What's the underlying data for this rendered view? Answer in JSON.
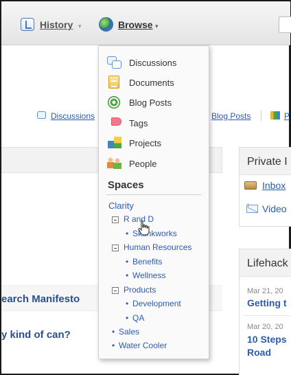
{
  "toolbar": {
    "history_label": "History",
    "history_caret": "▾",
    "browse_label": "Browse",
    "browse_caret": "▾"
  },
  "background": {
    "tab_discussions": "Discussions",
    "tab_blog_posts": "Blog Posts",
    "tab_p": "P",
    "left_text_1": "earch Manifesto",
    "left_text_2": "y kind of can?",
    "private_title": "Private I",
    "inbox_label": "Inbox",
    "video_label": "Video",
    "lifehacker_title": "Lifehack",
    "life_date_1": "Mar 21, 20",
    "life_link_1": "Getting t",
    "life_date_2": "Mar 20, 20",
    "life_link_2a": "10 Steps",
    "life_link_2b": "Road"
  },
  "browse_menu": {
    "items": [
      {
        "label": "Discussions",
        "icon": "discussions-icon"
      },
      {
        "label": "Documents",
        "icon": "documents-icon"
      },
      {
        "label": "Blog Posts",
        "icon": "blog-posts-icon"
      },
      {
        "label": "Tags",
        "icon": "tags-icon"
      },
      {
        "label": "Projects",
        "icon": "projects-icon"
      },
      {
        "label": "People",
        "icon": "people-icon"
      }
    ],
    "spaces_heading": "Spaces",
    "spaces": {
      "root": "Clarity",
      "r_and_d": "R and D",
      "skunkworks": "Skunkworks",
      "human_resources": "Human Resources",
      "benefits": "Benefits",
      "wellness": "Wellness",
      "products": "Products",
      "development": "Development",
      "qa": "QA",
      "sales": "Sales",
      "water_cooler": "Water Cooler"
    },
    "bullet": "•"
  },
  "colors": {
    "link": "#2a5bb0",
    "menu_background": "#fafafa",
    "toolbar_gradient_top": "#f6f6f6",
    "toolbar_gradient_bottom": "#e4e4e4"
  }
}
